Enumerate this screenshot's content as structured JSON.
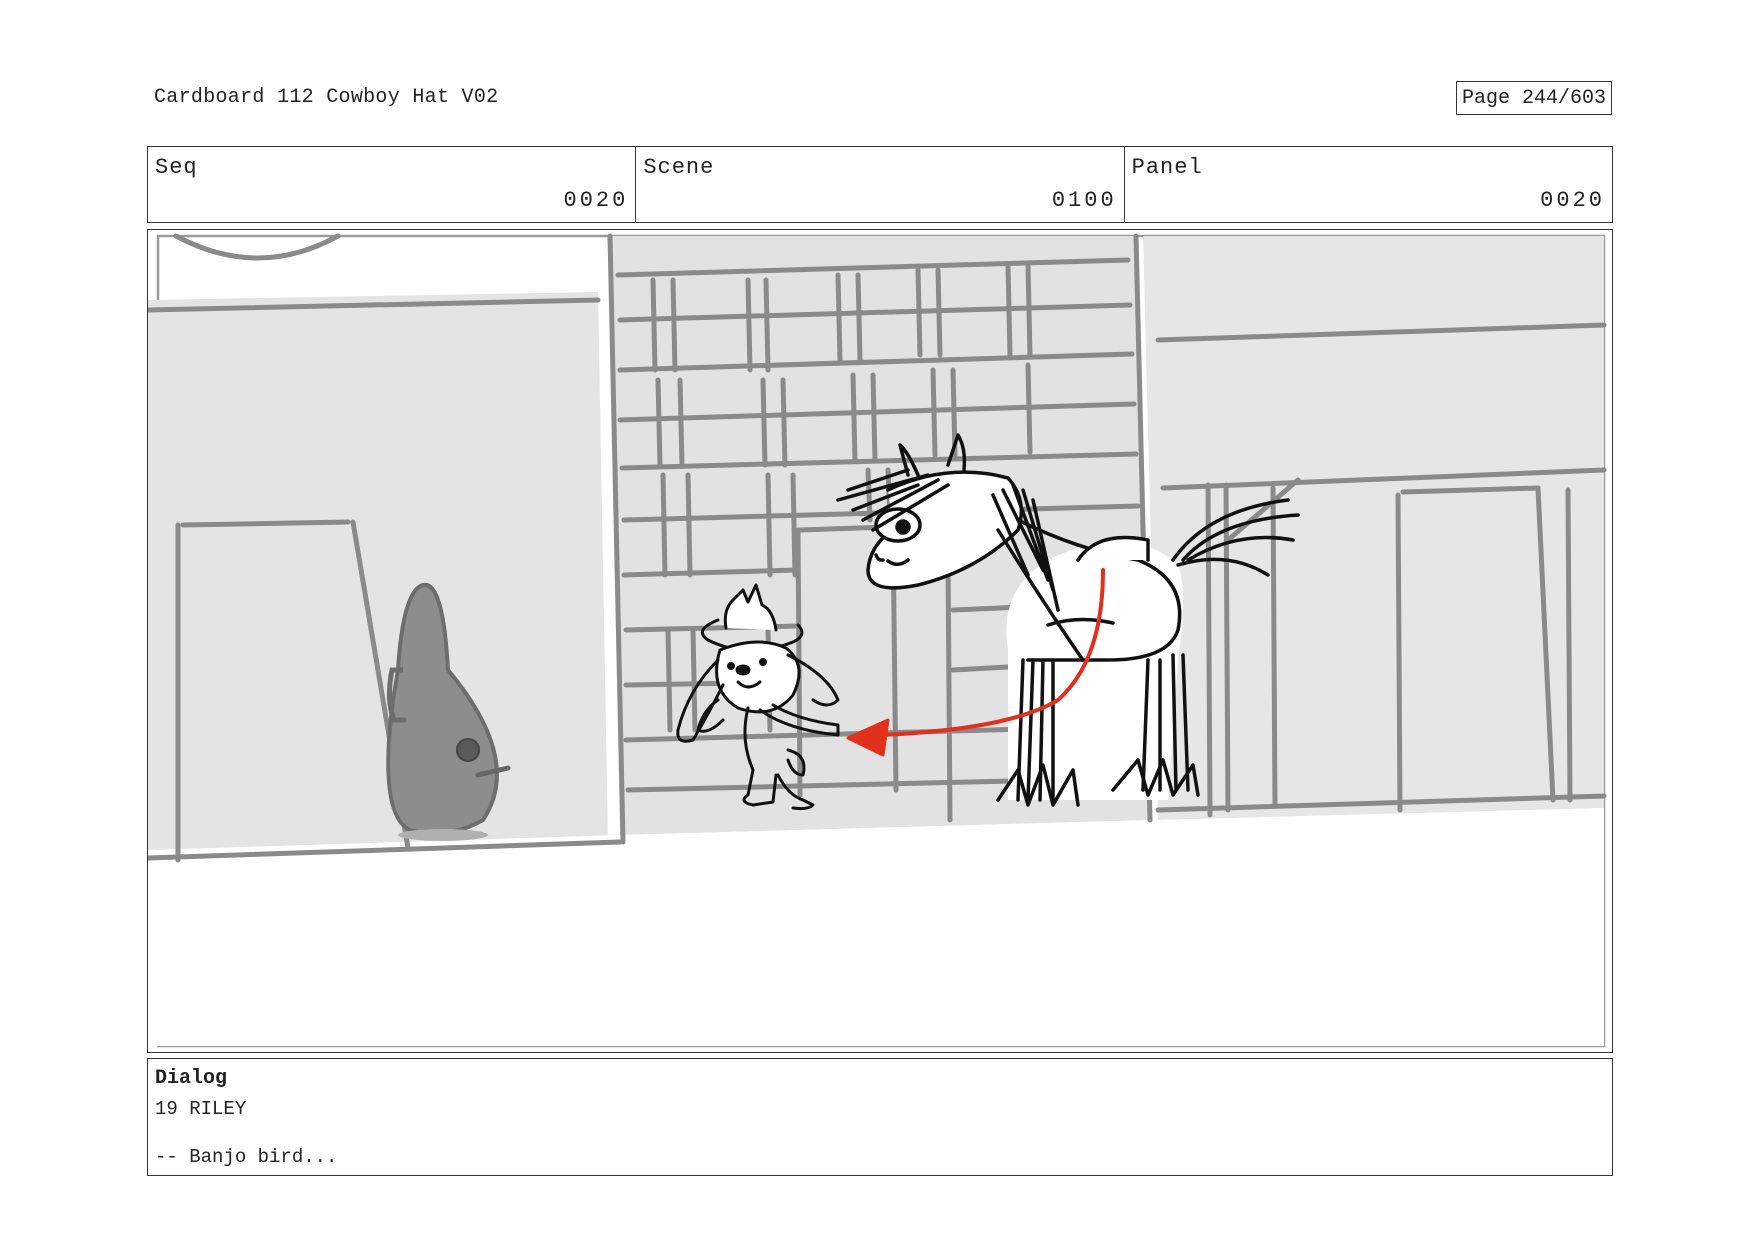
{
  "document": {
    "title": "Cardboard 112 Cowboy Hat V02",
    "page_label": "Page 244/603"
  },
  "meta": {
    "seq_label": "Seq",
    "seq_value": "0020",
    "scene_label": "Scene",
    "scene_value": "0100",
    "panel_label": "Panel",
    "panel_value": "0020"
  },
  "dialog": {
    "heading": "Dialog",
    "speaker": "19 RILEY",
    "line": "-- Banjo bird..."
  },
  "colors": {
    "sketch_gray": "#8a8a8a",
    "background_wall": "#e6e6e6",
    "ink": "#111111",
    "arrow_red": "#e0301e"
  }
}
